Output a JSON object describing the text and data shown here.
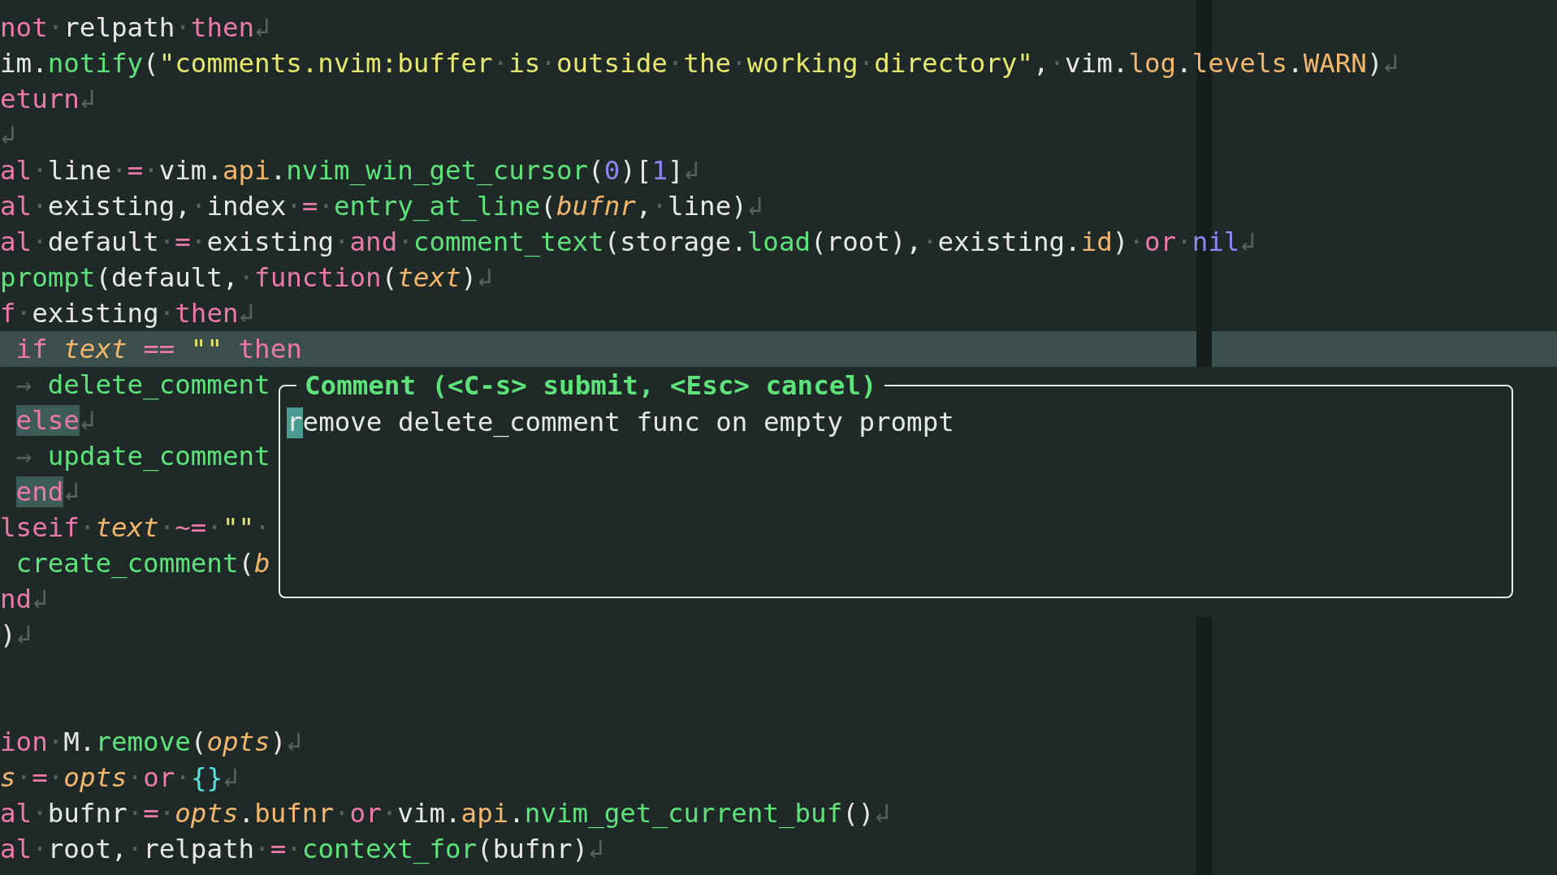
{
  "editor": {
    "lines": [
      {
        "current": false,
        "tokens": [
          {
            "kind": "kw",
            "text": "not"
          },
          {
            "kind": "ws",
            "text": "·"
          },
          {
            "kind": "plain",
            "text": "relpath"
          },
          {
            "kind": "ws",
            "text": "·"
          },
          {
            "kind": "kw",
            "text": "then"
          },
          {
            "kind": "ws",
            "text": "↲"
          }
        ]
      },
      {
        "current": false,
        "tokens": [
          {
            "kind": "plain",
            "text": "im."
          },
          {
            "kind": "fn",
            "text": "notify"
          },
          {
            "kind": "plain",
            "text": "("
          },
          {
            "kind": "str",
            "text": "\"comments.nvim:buffer"
          },
          {
            "kind": "ws",
            "text": "·"
          },
          {
            "kind": "str",
            "text": "is"
          },
          {
            "kind": "ws",
            "text": "·"
          },
          {
            "kind": "str",
            "text": "outside"
          },
          {
            "kind": "ws",
            "text": "·"
          },
          {
            "kind": "str",
            "text": "the"
          },
          {
            "kind": "ws",
            "text": "·"
          },
          {
            "kind": "str",
            "text": "working"
          },
          {
            "kind": "ws",
            "text": "·"
          },
          {
            "kind": "str",
            "text": "directory\""
          },
          {
            "kind": "plain",
            "text": ","
          },
          {
            "kind": "ws",
            "text": "·"
          },
          {
            "kind": "plain",
            "text": "vim."
          },
          {
            "kind": "prop",
            "text": "log"
          },
          {
            "kind": "plain",
            "text": "."
          },
          {
            "kind": "prop",
            "text": "levels"
          },
          {
            "kind": "plain",
            "text": "."
          },
          {
            "kind": "prop",
            "text": "WARN"
          },
          {
            "kind": "plain",
            "text": ")"
          },
          {
            "kind": "ws",
            "text": "↲"
          }
        ]
      },
      {
        "current": false,
        "tokens": [
          {
            "kind": "kw",
            "text": "eturn"
          },
          {
            "kind": "ws",
            "text": "↲"
          }
        ]
      },
      {
        "current": false,
        "tokens": [
          {
            "kind": "ws",
            "text": "↲"
          }
        ]
      },
      {
        "current": false,
        "tokens": [
          {
            "kind": "kw",
            "text": "al"
          },
          {
            "kind": "ws",
            "text": "·"
          },
          {
            "kind": "plain",
            "text": "line"
          },
          {
            "kind": "ws",
            "text": "·"
          },
          {
            "kind": "kw",
            "text": "="
          },
          {
            "kind": "ws",
            "text": "·"
          },
          {
            "kind": "plain",
            "text": "vim."
          },
          {
            "kind": "prop",
            "text": "api"
          },
          {
            "kind": "plain",
            "text": "."
          },
          {
            "kind": "fn",
            "text": "nvim_win_get_cursor"
          },
          {
            "kind": "plain",
            "text": "("
          },
          {
            "kind": "num",
            "text": "0"
          },
          {
            "kind": "plain",
            "text": ")["
          },
          {
            "kind": "num",
            "text": "1"
          },
          {
            "kind": "plain",
            "text": "]"
          },
          {
            "kind": "ws",
            "text": "↲"
          }
        ]
      },
      {
        "current": false,
        "tokens": [
          {
            "kind": "kw",
            "text": "al"
          },
          {
            "kind": "ws",
            "text": "·"
          },
          {
            "kind": "plain",
            "text": "existing,"
          },
          {
            "kind": "ws",
            "text": "·"
          },
          {
            "kind": "plain",
            "text": "index"
          },
          {
            "kind": "ws",
            "text": "·"
          },
          {
            "kind": "kw",
            "text": "="
          },
          {
            "kind": "ws",
            "text": "·"
          },
          {
            "kind": "fn",
            "text": "entry_at_line"
          },
          {
            "kind": "plain",
            "text": "("
          },
          {
            "kind": "param",
            "text": "bufnr"
          },
          {
            "kind": "plain",
            "text": ","
          },
          {
            "kind": "ws",
            "text": "·"
          },
          {
            "kind": "plain",
            "text": "line)"
          },
          {
            "kind": "ws",
            "text": "↲"
          }
        ]
      },
      {
        "current": false,
        "tokens": [
          {
            "kind": "kw",
            "text": "al"
          },
          {
            "kind": "ws",
            "text": "·"
          },
          {
            "kind": "plain",
            "text": "default"
          },
          {
            "kind": "ws",
            "text": "·"
          },
          {
            "kind": "kw",
            "text": "="
          },
          {
            "kind": "ws",
            "text": "·"
          },
          {
            "kind": "plain",
            "text": "existing"
          },
          {
            "kind": "ws",
            "text": "·"
          },
          {
            "kind": "kw",
            "text": "and"
          },
          {
            "kind": "ws",
            "text": "·"
          },
          {
            "kind": "fn",
            "text": "comment_text"
          },
          {
            "kind": "plain",
            "text": "(storage."
          },
          {
            "kind": "fn",
            "text": "load"
          },
          {
            "kind": "plain",
            "text": "(root),"
          },
          {
            "kind": "ws",
            "text": "·"
          },
          {
            "kind": "plain",
            "text": "existing."
          },
          {
            "kind": "prop",
            "text": "id"
          },
          {
            "kind": "plain",
            "text": ")"
          },
          {
            "kind": "ws",
            "text": "·"
          },
          {
            "kind": "kw",
            "text": "or"
          },
          {
            "kind": "ws",
            "text": "·"
          },
          {
            "kind": "num",
            "text": "nil"
          },
          {
            "kind": "ws",
            "text": "↲"
          }
        ]
      },
      {
        "current": false,
        "tokens": [
          {
            "kind": "fn",
            "text": "prompt"
          },
          {
            "kind": "plain",
            "text": "(default,"
          },
          {
            "kind": "ws",
            "text": "·"
          },
          {
            "kind": "kw",
            "text": "function"
          },
          {
            "kind": "plain",
            "text": "("
          },
          {
            "kind": "param",
            "text": "text"
          },
          {
            "kind": "plain",
            "text": ")"
          },
          {
            "kind": "ws",
            "text": "↲"
          }
        ]
      },
      {
        "current": false,
        "tokens": [
          {
            "kind": "kw",
            "text": "f"
          },
          {
            "kind": "ws",
            "text": "·"
          },
          {
            "kind": "plain",
            "text": "existing"
          },
          {
            "kind": "ws",
            "text": "·"
          },
          {
            "kind": "kw",
            "text": "then"
          },
          {
            "kind": "ws",
            "text": "↲"
          }
        ]
      },
      {
        "current": true,
        "tokens": [
          {
            "kind": "kw",
            "text": " if "
          },
          {
            "kind": "param",
            "text": "text "
          },
          {
            "kind": "kw",
            "text": "== "
          },
          {
            "kind": "str",
            "text": "\"\" "
          },
          {
            "kind": "kw",
            "text": "then"
          }
        ]
      },
      {
        "current": false,
        "tokens": [
          {
            "kind": "ws",
            "text": " → "
          },
          {
            "kind": "fn",
            "text": "delete_comment"
          }
        ]
      },
      {
        "current": false,
        "tokens": [
          {
            "kind": "kw_match",
            "text": " else"
          },
          {
            "kind": "ws",
            "text": "↲"
          }
        ]
      },
      {
        "current": false,
        "tokens": [
          {
            "kind": "ws",
            "text": " → "
          },
          {
            "kind": "fn",
            "text": "update_comment"
          }
        ]
      },
      {
        "current": false,
        "tokens": [
          {
            "kind": "kw_match",
            "text": " end"
          },
          {
            "kind": "ws",
            "text": "↲"
          }
        ]
      },
      {
        "current": false,
        "tokens": [
          {
            "kind": "kw",
            "text": "lseif"
          },
          {
            "kind": "ws",
            "text": "·"
          },
          {
            "kind": "param",
            "text": "text"
          },
          {
            "kind": "ws",
            "text": "·"
          },
          {
            "kind": "kw",
            "text": "~="
          },
          {
            "kind": "ws",
            "text": "·"
          },
          {
            "kind": "str",
            "text": "\"\""
          },
          {
            "kind": "ws",
            "text": "·"
          }
        ]
      },
      {
        "current": false,
        "tokens": [
          {
            "kind": "fn",
            "text": " create_comment"
          },
          {
            "kind": "plain",
            "text": "("
          },
          {
            "kind": "param",
            "text": "b"
          }
        ]
      },
      {
        "current": false,
        "tokens": [
          {
            "kind": "kw",
            "text": "nd"
          },
          {
            "kind": "ws",
            "text": "↲"
          }
        ]
      },
      {
        "current": false,
        "tokens": [
          {
            "kind": "plain",
            "text": ")"
          },
          {
            "kind": "ws",
            "text": "↲"
          }
        ]
      },
      {
        "current": false
      },
      {
        "current": false
      },
      {
        "current": false,
        "tokens": [
          {
            "kind": "kw",
            "text": "ion"
          },
          {
            "kind": "ws",
            "text": "·"
          },
          {
            "kind": "plain",
            "text": "M."
          },
          {
            "kind": "fn",
            "text": "remove"
          },
          {
            "kind": "plain",
            "text": "("
          },
          {
            "kind": "param",
            "text": "opts"
          },
          {
            "kind": "plain",
            "text": ")"
          },
          {
            "kind": "ws",
            "text": "↲"
          }
        ]
      },
      {
        "current": false,
        "tokens": [
          {
            "kind": "param",
            "text": "s"
          },
          {
            "kind": "ws",
            "text": "·"
          },
          {
            "kind": "kw",
            "text": "="
          },
          {
            "kind": "ws",
            "text": "·"
          },
          {
            "kind": "param",
            "text": "opts"
          },
          {
            "kind": "ws",
            "text": "·"
          },
          {
            "kind": "kw",
            "text": "or"
          },
          {
            "kind": "ws",
            "text": "·"
          },
          {
            "kind": "brace",
            "text": "{}"
          },
          {
            "kind": "ws",
            "text": "↲"
          }
        ]
      },
      {
        "current": false,
        "tokens": [
          {
            "kind": "kw",
            "text": "al"
          },
          {
            "kind": "ws",
            "text": "·"
          },
          {
            "kind": "plain",
            "text": "bufnr"
          },
          {
            "kind": "ws",
            "text": "·"
          },
          {
            "kind": "kw",
            "text": "="
          },
          {
            "kind": "ws",
            "text": "·"
          },
          {
            "kind": "param",
            "text": "opts"
          },
          {
            "kind": "plain",
            "text": "."
          },
          {
            "kind": "prop",
            "text": "bufnr"
          },
          {
            "kind": "ws",
            "text": "·"
          },
          {
            "kind": "kw",
            "text": "or"
          },
          {
            "kind": "ws",
            "text": "·"
          },
          {
            "kind": "plain",
            "text": "vim."
          },
          {
            "kind": "prop",
            "text": "api"
          },
          {
            "kind": "plain",
            "text": "."
          },
          {
            "kind": "fn",
            "text": "nvim_get_current_buf"
          },
          {
            "kind": "plain",
            "text": "()"
          },
          {
            "kind": "ws",
            "text": "↲"
          }
        ]
      },
      {
        "current": false,
        "tokens": [
          {
            "kind": "kw",
            "text": "al"
          },
          {
            "kind": "ws",
            "text": "·"
          },
          {
            "kind": "plain",
            "text": "root,"
          },
          {
            "kind": "ws",
            "text": "·"
          },
          {
            "kind": "plain",
            "text": "relpath"
          },
          {
            "kind": "ws",
            "text": "·"
          },
          {
            "kind": "kw",
            "text": "="
          },
          {
            "kind": "ws",
            "text": "·"
          },
          {
            "kind": "fn",
            "text": "context_for"
          },
          {
            "kind": "plain",
            "text": "(bufnr)"
          },
          {
            "kind": "ws",
            "text": "↲"
          }
        ]
      }
    ]
  },
  "popup": {
    "title": "Comment (<C-s> submit, <Esc> cancel)",
    "value": "remove delete_comment func on empty prompt"
  }
}
